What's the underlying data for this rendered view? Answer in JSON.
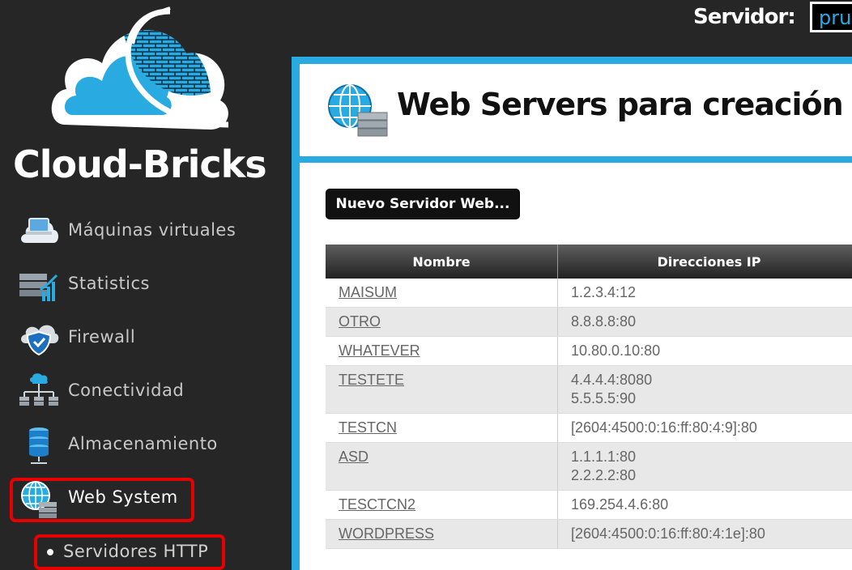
{
  "header": {
    "server_label": "Servidor:",
    "server_value": "pru"
  },
  "brand": "Cloud-Bricks",
  "sidebar": {
    "items": [
      {
        "label": "Máquinas virtuales",
        "icon": "vm-cloud-icon"
      },
      {
        "label": "Statistics",
        "icon": "statistics-icon"
      },
      {
        "label": "Firewall",
        "icon": "firewall-shield-icon"
      },
      {
        "label": "Conectividad",
        "icon": "network-icon"
      },
      {
        "label": "Almacenamiento",
        "icon": "database-icon"
      },
      {
        "label": "Web System",
        "icon": "globe-server-icon"
      }
    ],
    "sub_items": [
      {
        "label": "Servidores HTTP"
      }
    ]
  },
  "main": {
    "title": "Web Servers para creación de Virt",
    "new_button": "Nuevo Servidor Web...",
    "table": {
      "columns": [
        "Nombre",
        "Direcciones IP"
      ],
      "rows": [
        {
          "name": "MAISUM",
          "ips": [
            "1.2.3.4:12"
          ]
        },
        {
          "name": "OTRO",
          "ips": [
            "8.8.8.8:80"
          ]
        },
        {
          "name": "WHATEVER",
          "ips": [
            "10.80.0.10:80"
          ]
        },
        {
          "name": "TESTETE",
          "ips": [
            "4.4.4.4:8080",
            "5.5.5.5:90"
          ]
        },
        {
          "name": "TESTCN",
          "ips": [
            "[2604:4500:0:16:ff:80:4:9]:80"
          ]
        },
        {
          "name": "ASD",
          "ips": [
            "1.1.1.1:80",
            "2.2.2.2:80"
          ]
        },
        {
          "name": "TESCTCN2",
          "ips": [
            "169.254.4.6:80"
          ]
        },
        {
          "name": "WORDPRESS",
          "ips": [
            "[2604:4500:0:16:ff:80:4:1e]:80"
          ]
        }
      ]
    }
  },
  "colors": {
    "accent_blue": "#29abe2",
    "highlight_red": "#e60000",
    "sidebar_bg": "#262626"
  }
}
